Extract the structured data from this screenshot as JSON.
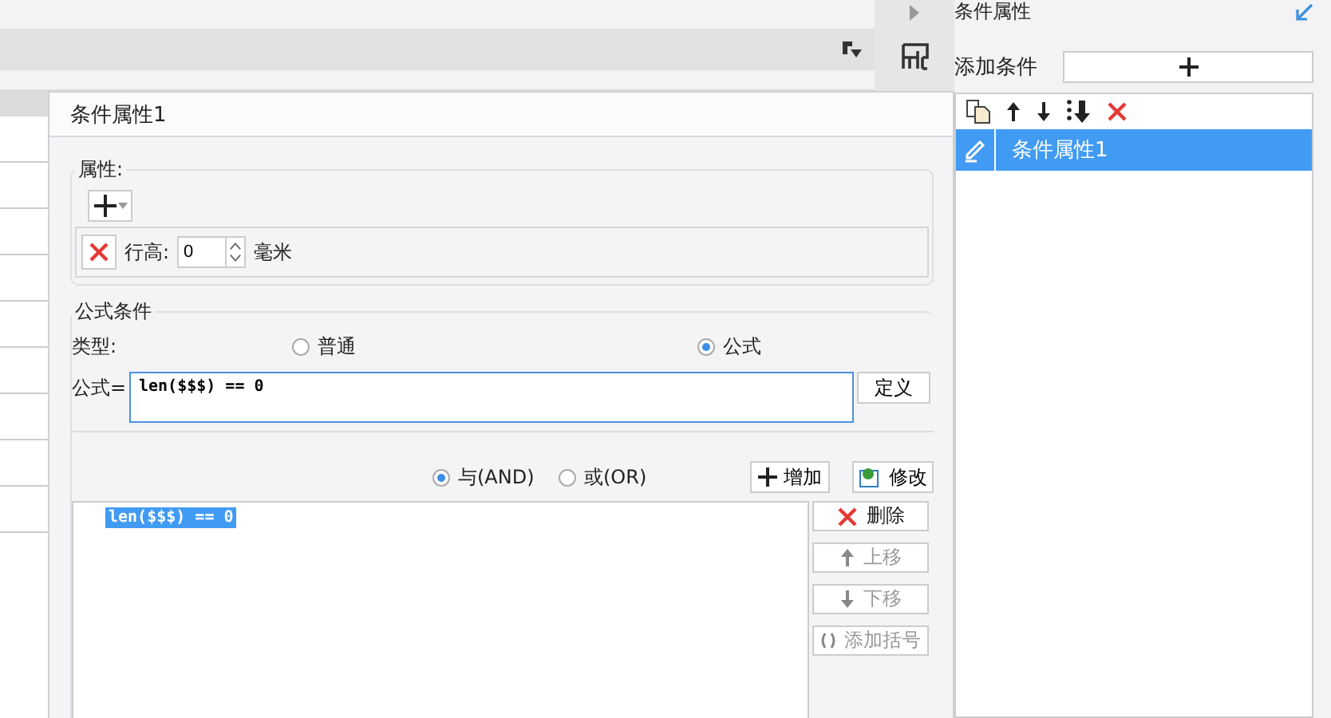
{
  "dialog": {
    "title": "条件属性1",
    "attributes": {
      "legend": "属性:",
      "rows": [
        {
          "label": "行高:",
          "value": "0",
          "unit": "毫米"
        }
      ]
    },
    "formula_condition": {
      "legend": "公式条件",
      "type_label": "类型:",
      "types": [
        {
          "label": "普通",
          "selected": false
        },
        {
          "label": "公式",
          "selected": true
        }
      ],
      "formula_label": "公式=",
      "formula_value": "len($$$) == 0",
      "define_button": "定义",
      "logic": [
        {
          "label": "与(AND)",
          "selected": true
        },
        {
          "label": "或(OR)",
          "selected": false
        }
      ],
      "add_button": "增加",
      "modify_button": "修改",
      "conditions": [
        {
          "text": "len($$$) == 0",
          "selected": true
        }
      ],
      "actions": [
        {
          "label": "删除",
          "kind": "delete",
          "disabled": false
        },
        {
          "label": "上移",
          "kind": "up",
          "disabled": true
        },
        {
          "label": "下移",
          "kind": "down",
          "disabled": true
        },
        {
          "label": "添加括号",
          "kind": "brackets",
          "disabled": true
        }
      ]
    }
  },
  "side_panel": {
    "title": "条件属性",
    "add_label": "添加条件",
    "items": [
      {
        "label": "条件属性1",
        "selected": true
      }
    ]
  }
}
